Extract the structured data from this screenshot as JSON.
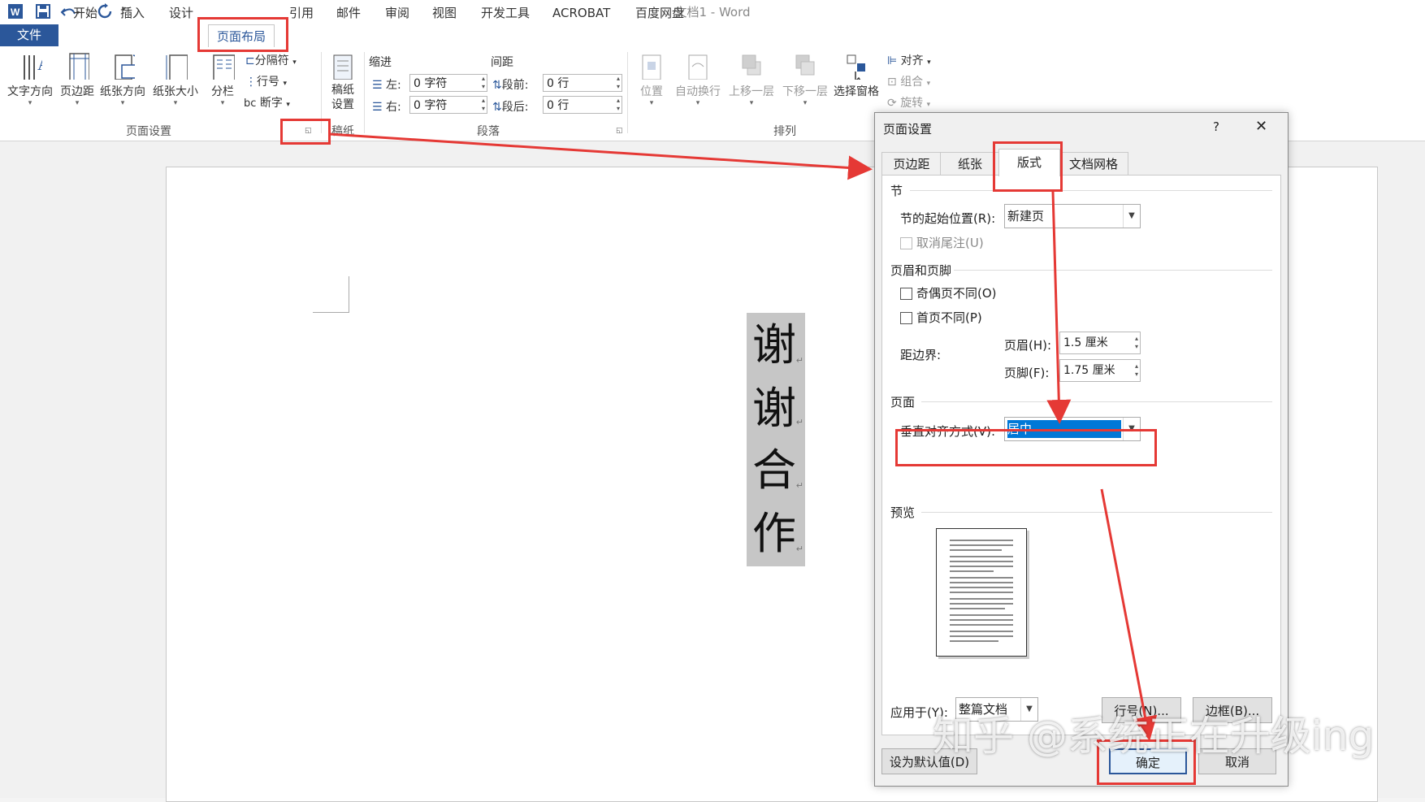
{
  "window": {
    "title": "文档1 - Word"
  },
  "tabs": {
    "file": "文件",
    "items": [
      "开始",
      "插入",
      "设计",
      "页面布局",
      "引用",
      "邮件",
      "审阅",
      "视图",
      "开发工具",
      "ACROBAT",
      "百度网盘"
    ]
  },
  "ribbon": {
    "page_setup": {
      "group_label": "页面设置",
      "text_direction": "文字方向",
      "margins": "页边距",
      "orientation": "纸张方向",
      "size": "纸张大小",
      "columns": "分栏",
      "breaks": "分隔符",
      "line_numbers": "行号",
      "hyphenation": "断字"
    },
    "manuscript": {
      "group_label": "稿纸",
      "button": "稿纸设置"
    },
    "paragraph": {
      "group_label": "段落",
      "indent_label": "缩进",
      "spacing_label": "间距",
      "left_label": "左:",
      "left_value": "0 字符",
      "right_label": "右:",
      "right_value": "0 字符",
      "before_label": "段前:",
      "before_value": "0 行",
      "after_label": "段后:",
      "after_value": "0 行"
    },
    "arrange": {
      "group_label": "排列",
      "position": "位置",
      "wrap": "自动换行",
      "forward": "上移一层",
      "backward": "下移一层",
      "pane": "选择窗格",
      "align": "对齐",
      "group": "组合",
      "rotate": "旋转"
    }
  },
  "document": {
    "chars": [
      "谢",
      "谢",
      "合",
      "作"
    ]
  },
  "dialog": {
    "title": "页面设置",
    "help": "?",
    "close": "✕",
    "tabs": [
      "页边距",
      "纸张",
      "版式",
      "文档网格"
    ],
    "section": {
      "title": "节",
      "start_label": "节的起始位置(R):",
      "start_value": "新建页",
      "suppress_endnotes": "取消尾注(U)"
    },
    "headers": {
      "title": "页眉和页脚",
      "odd_even": "奇偶页不同(O)",
      "first_page": "首页不同(P)",
      "from_edge": "距边界:",
      "header_label": "页眉(H):",
      "header_value": "1.5 厘米",
      "footer_label": "页脚(F):",
      "footer_value": "1.75 厘米"
    },
    "page": {
      "title": "页面",
      "valign_label": "垂直对齐方式(V):",
      "valign_value": "居中"
    },
    "preview": {
      "title": "预览"
    },
    "apply_label": "应用于(Y):",
    "apply_value": "整篇文档",
    "line_numbers_button": "行号(N)...",
    "borders_button": "边框(B)...",
    "default_button": "设为默认值(D)",
    "ok_button": "确定",
    "cancel_button": "取消"
  },
  "watermark": "知乎 @系统正在升级ing",
  "colors": {
    "accent": "#2b579a",
    "annotation": "#e53935",
    "selection": "#0078d7"
  }
}
